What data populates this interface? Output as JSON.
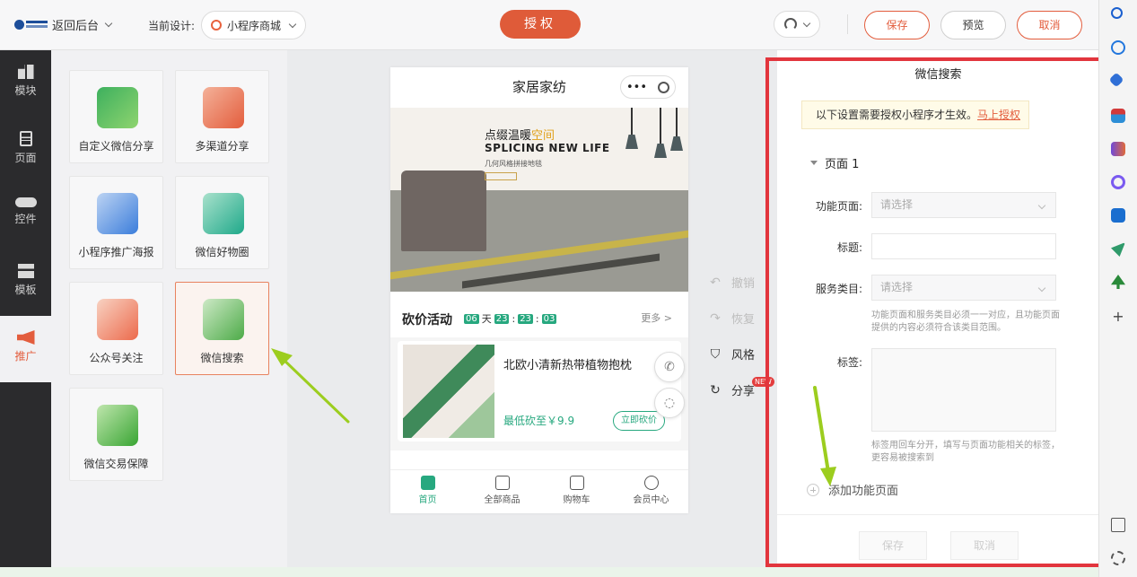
{
  "topbar": {
    "back_label": "返回后台",
    "current_design_label": "当前设计:",
    "design_name": "小程序商城",
    "auth_button": "授权",
    "save_button": "保存",
    "preview_button": "预览",
    "cancel_button": "取消"
  },
  "rail": {
    "items": [
      {
        "label": "模块"
      },
      {
        "label": "页面"
      },
      {
        "label": "控件"
      },
      {
        "label": "模板"
      },
      {
        "label": "推广"
      }
    ]
  },
  "components": {
    "cards": [
      {
        "label": "自定义微信分享"
      },
      {
        "label": "多渠道分享"
      },
      {
        "label": "小程序推广海报"
      },
      {
        "label": "微信好物圈"
      },
      {
        "label": "公众号关注"
      },
      {
        "label": "微信搜索"
      },
      {
        "label": "微信交易保障"
      }
    ]
  },
  "phone": {
    "title": "家居家纺",
    "banner_line1": "点缀温暖",
    "banner_line1_accent": "空间",
    "banner_line2": "SPLICING NEW LIFE",
    "banner_line3": "几何风格拼接地毯",
    "bargain_title": "砍价活动",
    "timer_days": "06",
    "timer_day_unit": "天",
    "timer_h": "23",
    "timer_m": "23",
    "timer_s": "03",
    "more": "更多 >",
    "product_name": "北欧小清新热带植物抱枕",
    "product_price": "最低砍至￥9.9",
    "product_button": "立即砍价",
    "tabs": [
      {
        "label": "首页"
      },
      {
        "label": "全部商品"
      },
      {
        "label": "购物车"
      },
      {
        "label": "会员中心"
      }
    ]
  },
  "tools": {
    "undo": "撤销",
    "redo": "恢复",
    "style": "风格",
    "share": "分享",
    "new_badge": "NEW"
  },
  "settings": {
    "title": "微信搜索",
    "notice_text": "以下设置需要授权小程序才生效。",
    "notice_link": "马上授权",
    "section_title": "页面 1",
    "function_page_label": "功能页面:",
    "function_page_placeholder": "请选择",
    "title_label": "标题:",
    "title_value": "",
    "service_label": "服务类目:",
    "service_placeholder": "请选择",
    "service_hint": "功能页面和服务类目必须一一对应，且功能页面提供的内容必须符合该类目范围。",
    "tags_label": "标签:",
    "tags_value": "",
    "tags_hint": "标签用回车分开，填写与页面功能相关的标签，更容易被搜索到",
    "add_function_page": "添加功能页面",
    "save_button": "保存",
    "cancel_button": "取消"
  },
  "colors": {
    "accent": "#df5b39",
    "highlight": "#e2353d",
    "annotation_arrow": "#9ccd1f",
    "phone_theme": "#27a87f"
  }
}
